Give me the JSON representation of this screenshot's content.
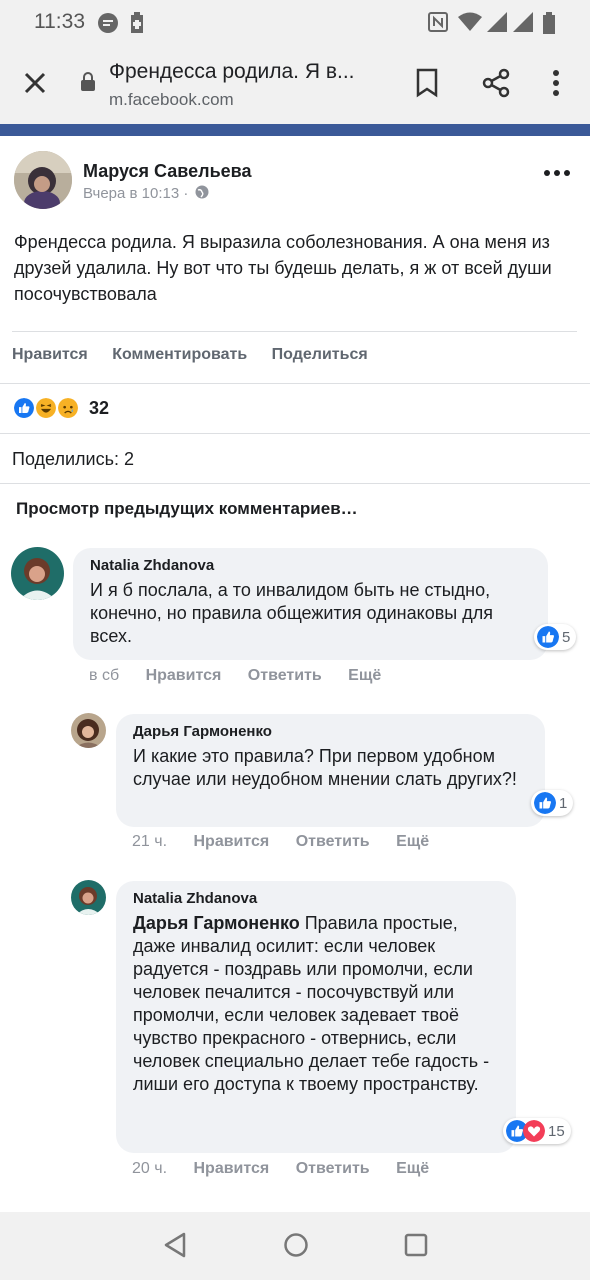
{
  "status": {
    "time": "11:33"
  },
  "browser": {
    "title": "Френдесса родила. Я в...",
    "url": "m.facebook.com"
  },
  "post": {
    "author": "Маруся Савельева",
    "time": "Вчера в 10:13 ·",
    "text": "Френдесса родила. Я выразила соболезнования. А она меня из друзей удалила. Ну вот что ты будешь делать, я ж от всей души посочувствовала",
    "actions": {
      "like": "Нравится",
      "comment": "Комментировать",
      "share": "Поделиться"
    },
    "reaction_count": "32",
    "shares": "Поделились: 2",
    "prev_comments": "Просмотр предыдущих комментариев…"
  },
  "comments": [
    {
      "name": "Natalia Zhdanova",
      "text": "И я б послала, а то инвалидом быть не стыдно, конечно, но правила общежития одинаковы для всех.",
      "time": "в сб",
      "like": "Нравится",
      "reply": "Ответить",
      "more": "Ещё",
      "reactions": "5"
    },
    {
      "name": "Дарья Гармоненко",
      "text": "И какие это правила? При первом удобном случае или неудобном мнении слать других?!",
      "time": "21 ч.",
      "like": "Нравится",
      "reply": "Ответить",
      "more": "Ещё",
      "reactions": "1"
    },
    {
      "name": "Natalia Zhdanova",
      "mention": "Дарья Гармоненко",
      "text": " Правила простые, даже инвалид осилит: если человек радуется - поздравь или промолчи, если человек печалится - посочувствуй или промолчи, если человек задевает твоё чувство прекрасного - отвернись, если человек специально делает тебе гадость - лиши его доступа к твоему пространству.",
      "time": "20 ч.",
      "like": "Нравится",
      "reply": "Ответить",
      "more": "Ещё",
      "reactions": "15"
    }
  ],
  "colors": {
    "fb_blue": "#3b5998",
    "like_blue": "#1877f2",
    "love_red": "#f33e58",
    "haha_yellow": "#f7b125"
  }
}
